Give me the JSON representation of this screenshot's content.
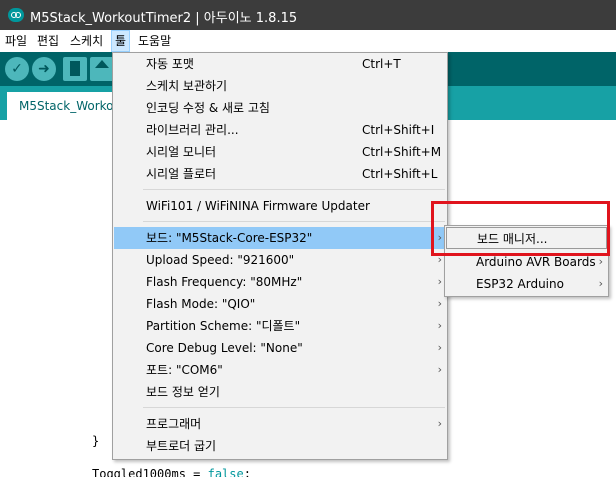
{
  "window": {
    "title": "M5Stack_WorkoutTimer2 | 아두이노 1.8.15"
  },
  "menubar": {
    "items": [
      {
        "label": "파일"
      },
      {
        "label": "편집"
      },
      {
        "label": "스케치"
      },
      {
        "label": "툴"
      },
      {
        "label": "도움말"
      }
    ]
  },
  "tabs": [
    {
      "label": "M5Stack_WorkoutTimer2"
    }
  ],
  "tools_menu": {
    "items": [
      {
        "label": "자동 포맷",
        "shortcut": "Ctrl+T"
      },
      {
        "label": "스케치 보관하기",
        "shortcut": ""
      },
      {
        "label": "인코딩 수정 & 새로 고침",
        "shortcut": ""
      },
      {
        "label": "라이브러리 관리...",
        "shortcut": "Ctrl+Shift+I"
      },
      {
        "label": "시리얼 모니터",
        "shortcut": "Ctrl+Shift+M"
      },
      {
        "label": "시리얼 플로터",
        "shortcut": "Ctrl+Shift+L"
      },
      {
        "label": "WiFi101 / WiFiNINA Firmware Updater",
        "shortcut": ""
      },
      {
        "label": "보드: \"M5Stack-Core-ESP32\"",
        "shortcut": ""
      },
      {
        "label": "Upload Speed: \"921600\"",
        "shortcut": ""
      },
      {
        "label": "Flash Frequency: \"80MHz\"",
        "shortcut": ""
      },
      {
        "label": "Flash Mode: \"QIO\"",
        "shortcut": ""
      },
      {
        "label": "Partition Scheme: \"디폴트\"",
        "shortcut": ""
      },
      {
        "label": "Core Debug Level: \"None\"",
        "shortcut": ""
      },
      {
        "label": "포트: \"COM6\"",
        "shortcut": ""
      },
      {
        "label": "보드 정보 얻기",
        "shortcut": ""
      },
      {
        "label": "프로그래머",
        "shortcut": ""
      },
      {
        "label": "부트로더 굽기",
        "shortcut": ""
      }
    ]
  },
  "board_submenu": {
    "items": [
      {
        "label": "보드 매니저..."
      },
      {
        "label": "Arduino AVR Boards"
      },
      {
        "label": "ESP32 Arduino"
      }
    ]
  },
  "editor": {
    "brace": "}",
    "line_text": "Toggled1000ms = ",
    "line_keyword": "false",
    "line_end": ";"
  },
  "colors": {
    "toolbar": "#006468",
    "tabbar": "#17a1a5",
    "highlight": "#91c9f7",
    "annotation": "#e0141d"
  }
}
